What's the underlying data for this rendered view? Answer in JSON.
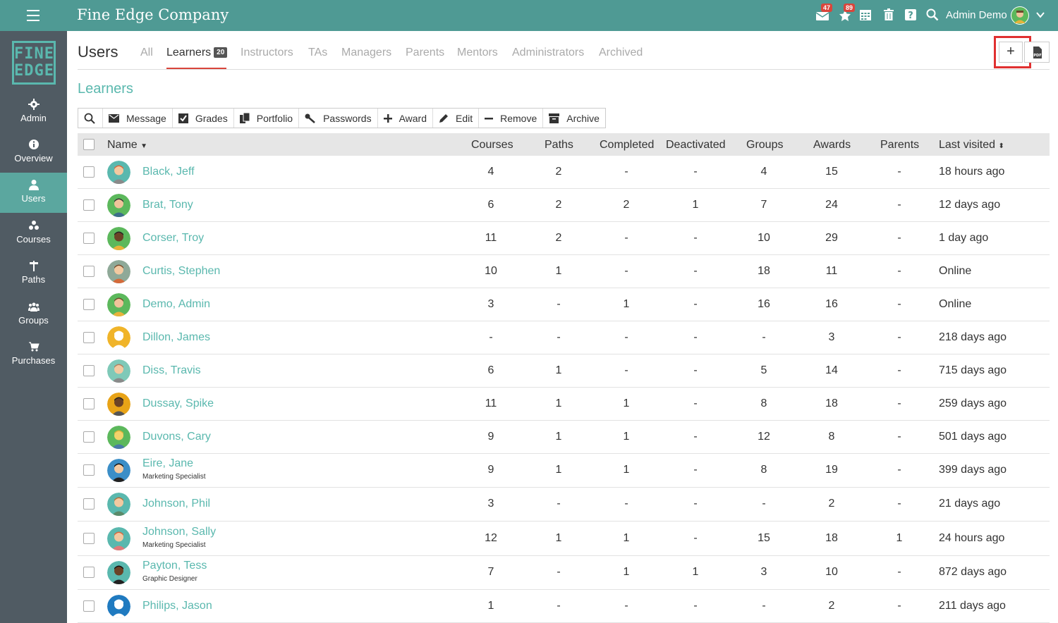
{
  "app": {
    "brand": "Fine Edge Company",
    "logo_line1": "FINE",
    "logo_line2": "EDGE",
    "messages_count": "47",
    "notifications_count": "89",
    "user_name": "Admin Demo"
  },
  "sidebar": {
    "items": [
      {
        "label": "Admin",
        "icon": "gear-icon"
      },
      {
        "label": "Overview",
        "icon": "info-icon"
      },
      {
        "label": "Users",
        "icon": "user-icon"
      },
      {
        "label": "Courses",
        "icon": "courses-icon"
      },
      {
        "label": "Paths",
        "icon": "signpost-icon"
      },
      {
        "label": "Groups",
        "icon": "group-icon"
      },
      {
        "label": "Purchases",
        "icon": "cart-icon"
      }
    ]
  },
  "header": {
    "title": "Users",
    "tabs": [
      "All",
      "Learners",
      "Instructors",
      "TAs",
      "Managers",
      "Parents",
      "Mentors",
      "Administrators",
      "Archived"
    ],
    "learners_count": "20",
    "add_label": "+"
  },
  "section_title": "Learners",
  "toolbar": {
    "message": "Message",
    "grades": "Grades",
    "portfolio": "Portfolio",
    "passwords": "Passwords",
    "award": "Award",
    "edit": "Edit",
    "remove": "Remove",
    "archive": "Archive"
  },
  "table": {
    "columns": [
      "Name",
      "Courses",
      "Paths",
      "Completed",
      "Deactivated",
      "Groups",
      "Awards",
      "Parents",
      "Last visited"
    ],
    "rows": [
      {
        "name": "Black, Jeff",
        "title": "",
        "courses": "4",
        "paths": "2",
        "completed": "-",
        "deactivated": "-",
        "groups": "4",
        "awards": "15",
        "parents": "-",
        "last": "18 hours ago"
      },
      {
        "name": "Brat, Tony",
        "title": "",
        "courses": "6",
        "paths": "2",
        "completed": "2",
        "deactivated": "1",
        "groups": "7",
        "awards": "24",
        "parents": "-",
        "last": "12 days ago"
      },
      {
        "name": "Corser, Troy",
        "title": "",
        "courses": "11",
        "paths": "2",
        "completed": "-",
        "deactivated": "-",
        "groups": "10",
        "awards": "29",
        "parents": "-",
        "last": "1 day ago"
      },
      {
        "name": "Curtis, Stephen",
        "title": "",
        "courses": "10",
        "paths": "1",
        "completed": "-",
        "deactivated": "-",
        "groups": "18",
        "awards": "11",
        "parents": "-",
        "last": "Online"
      },
      {
        "name": "Demo, Admin",
        "title": "",
        "courses": "3",
        "paths": "-",
        "completed": "1",
        "deactivated": "-",
        "groups": "16",
        "awards": "16",
        "parents": "-",
        "last": "Online"
      },
      {
        "name": "Dillon, James",
        "title": "",
        "courses": "-",
        "paths": "-",
        "completed": "-",
        "deactivated": "-",
        "groups": "-",
        "awards": "3",
        "parents": "-",
        "last": "218 days ago"
      },
      {
        "name": "Diss, Travis",
        "title": "",
        "courses": "6",
        "paths": "1",
        "completed": "-",
        "deactivated": "-",
        "groups": "5",
        "awards": "14",
        "parents": "-",
        "last": "715 days ago"
      },
      {
        "name": "Dussay, Spike",
        "title": "",
        "courses": "11",
        "paths": "1",
        "completed": "1",
        "deactivated": "-",
        "groups": "8",
        "awards": "18",
        "parents": "-",
        "last": "259 days ago"
      },
      {
        "name": "Duvons, Cary",
        "title": "",
        "courses": "9",
        "paths": "1",
        "completed": "1",
        "deactivated": "-",
        "groups": "12",
        "awards": "8",
        "parents": "-",
        "last": "501 days ago"
      },
      {
        "name": "Eire, Jane",
        "title": "Marketing Specialist",
        "courses": "9",
        "paths": "1",
        "completed": "1",
        "deactivated": "-",
        "groups": "8",
        "awards": "19",
        "parents": "-",
        "last": "399 days ago"
      },
      {
        "name": "Johnson, Phil",
        "title": "",
        "courses": "3",
        "paths": "-",
        "completed": "-",
        "deactivated": "-",
        "groups": "-",
        "awards": "2",
        "parents": "-",
        "last": "21 days ago"
      },
      {
        "name": "Johnson, Sally",
        "title": "Marketing Specialist",
        "courses": "12",
        "paths": "1",
        "completed": "1",
        "deactivated": "-",
        "groups": "15",
        "awards": "18",
        "parents": "1",
        "last": "24 hours ago"
      },
      {
        "name": "Payton, Tess",
        "title": "Graphic Designer",
        "courses": "7",
        "paths": "-",
        "completed": "1",
        "deactivated": "1",
        "groups": "3",
        "awards": "10",
        "parents": "-",
        "last": "872 days ago"
      },
      {
        "name": "Philips, Jason",
        "title": "",
        "courses": "1",
        "paths": "-",
        "completed": "-",
        "deactivated": "-",
        "groups": "-",
        "awards": "2",
        "parents": "-",
        "last": "211 days ago"
      }
    ]
  }
}
